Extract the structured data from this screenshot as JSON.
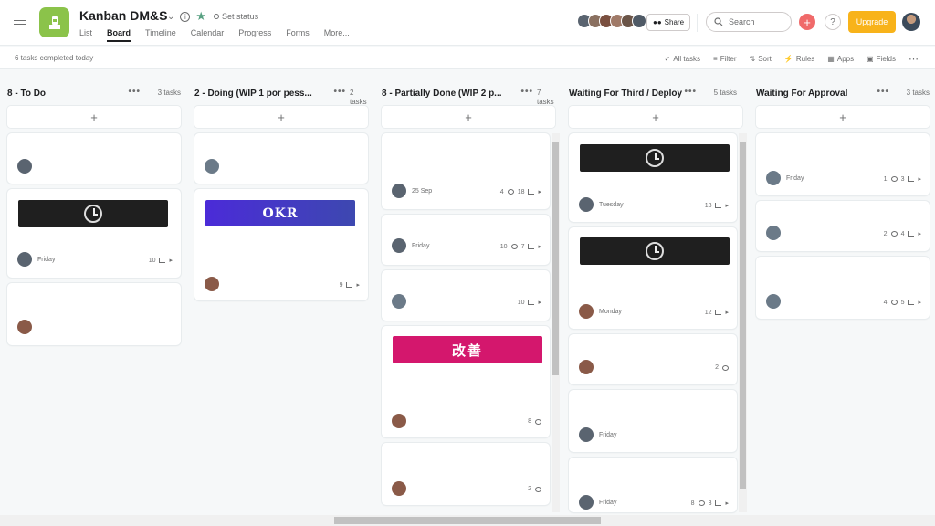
{
  "project": {
    "title": "Kanban DM&S",
    "set_status": "Set status",
    "icon_color": "#8bc34a"
  },
  "tabs": [
    "List",
    "Board",
    "Timeline",
    "Calendar",
    "Progress",
    "Forms",
    "More..."
  ],
  "active_tab": "Board",
  "header": {
    "share": "Share",
    "search_placeholder": "Search",
    "upgrade": "Upgrade",
    "help": "?"
  },
  "subbar": {
    "completed": "6 tasks completed today",
    "tools": [
      "All tasks",
      "Filter",
      "Sort",
      "Rules",
      "Apps",
      "Fields"
    ]
  },
  "columns": [
    {
      "title": "8 - To Do",
      "count": "3 tasks",
      "cards": [
        {
          "date": "",
          "comments": "",
          "subtasks": ""
        },
        {
          "cover": "clock",
          "date": "Friday",
          "comments": "",
          "subtasks": "10"
        },
        {
          "date": "",
          "comments": "",
          "subtasks": ""
        }
      ]
    },
    {
      "title": "2 - Doing (WIP 1 por pess...",
      "count": "2 tasks",
      "cards": [
        {
          "date": "",
          "comments": "",
          "subtasks": ""
        },
        {
          "cover": "okr",
          "cover_text": "OKR",
          "date": "",
          "comments": "",
          "subtasks": "9"
        }
      ]
    },
    {
      "title": "8 - Partially Done (WIP 2 p...",
      "count": "7 tasks",
      "cards": [
        {
          "date": "25 Sep",
          "comments": "4",
          "subtasks": "18"
        },
        {
          "date": "Friday",
          "comments": "10",
          "subtasks": "7"
        },
        {
          "date": "",
          "comments": "",
          "subtasks": "10"
        },
        {
          "cover": "kaizen",
          "cover_text": "改善",
          "date": "",
          "comments": "8",
          "subtasks": ""
        },
        {
          "date": "",
          "comments": "2",
          "subtasks": ""
        }
      ]
    },
    {
      "title": "Waiting For Third / Deploy",
      "count": "5 tasks",
      "cards": [
        {
          "cover": "clock",
          "date": "Tuesday",
          "comments": "",
          "subtasks": "18"
        },
        {
          "cover": "clock",
          "date": "Monday",
          "comments": "",
          "subtasks": "12"
        },
        {
          "date": "",
          "comments": "2",
          "subtasks": ""
        },
        {
          "date": "Friday",
          "comments": "",
          "subtasks": ""
        },
        {
          "date": "Friday",
          "comments": "8",
          "subtasks": "3"
        }
      ]
    },
    {
      "title": "Waiting For Approval",
      "count": "3 tasks",
      "cards": [
        {
          "date": "Friday",
          "comments": "1",
          "subtasks": "3"
        },
        {
          "date": "",
          "comments": "2",
          "subtasks": "4"
        },
        {
          "date": "",
          "comments": "4",
          "subtasks": "5"
        }
      ]
    }
  ]
}
